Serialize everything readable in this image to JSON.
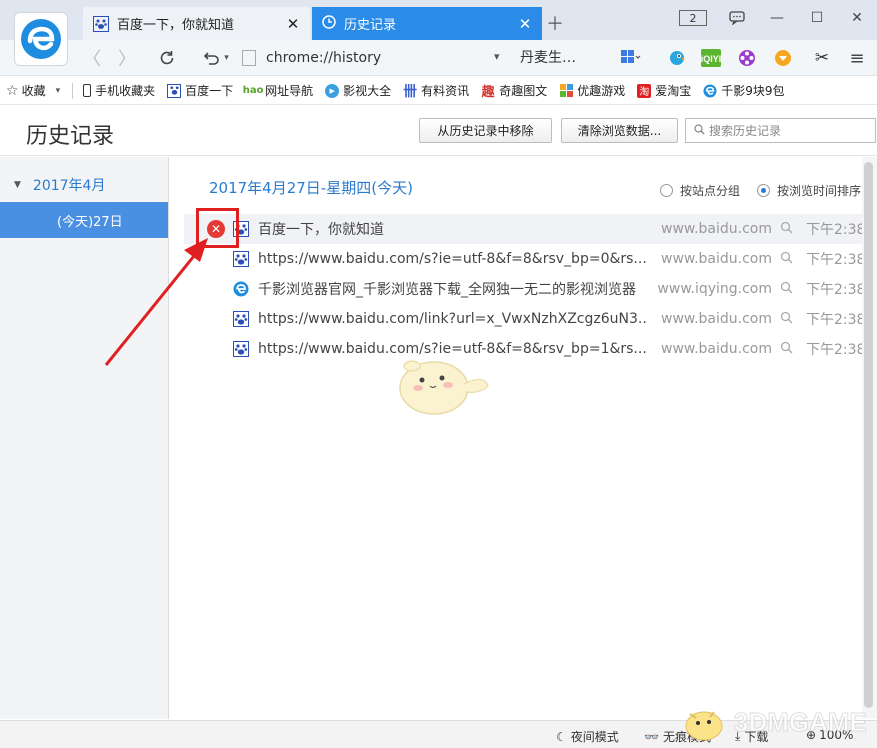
{
  "tabs": [
    {
      "label": "百度一下，你就知道",
      "icon": "baidu-paw-icon",
      "active": false
    },
    {
      "label": "历史记录",
      "icon": "clock-icon",
      "active": true
    }
  ],
  "window": {
    "counter": "2"
  },
  "navbar": {
    "address": "chrome://history",
    "search_engine": "丹麦生…"
  },
  "bookmarks": [
    {
      "label": "收藏",
      "icon": "star-icon"
    },
    {
      "label": "手机收藏夹",
      "icon": "phone-icon"
    },
    {
      "label": "百度一下",
      "icon": "baidu-paw-icon"
    },
    {
      "label": "网址导航",
      "icon": "hao-icon"
    },
    {
      "label": "影视大全",
      "icon": "video-icon"
    },
    {
      "label": "有料资讯",
      "icon": "news-icon"
    },
    {
      "label": "奇趣图文",
      "icon": "fun-icon"
    },
    {
      "label": "优趣游戏",
      "icon": "game-icon"
    },
    {
      "label": "爱淘宝",
      "icon": "taobao-icon"
    },
    {
      "label": "千影9块9包",
      "icon": "qianying-icon"
    }
  ],
  "header": {
    "title": "历史记录",
    "remove_button": "从历史记录中移除",
    "clear_button": "清除浏览数据...",
    "search_placeholder": "搜索历史记录"
  },
  "sidebar": {
    "month": "2017年4月",
    "day": "(今天)27日"
  },
  "main": {
    "date_heading": "2017年4月27日-星期四(今天)",
    "sort_by_site": "按站点分组",
    "sort_by_time": "按浏览时间排序",
    "selected_sort": "time"
  },
  "history_items": [
    {
      "title": "百度一下，你就知道",
      "domain": "www.baidu.com",
      "time": "下午2:38",
      "icon": "baidu-paw-icon",
      "hovered": true
    },
    {
      "title": "https://www.baidu.com/s?ie=utf-8&f=8&rsv_bp=0&rs...",
      "domain": "www.baidu.com",
      "time": "下午2:38",
      "icon": "baidu-paw-icon",
      "hovered": false
    },
    {
      "title": "千影浏览器官网_千影浏览器下载_全网独一无二的影视浏览器",
      "domain": "www.iqying.com",
      "time": "下午2:38",
      "icon": "qianying-icon",
      "hovered": false
    },
    {
      "title": "https://www.baidu.com/link?url=x_VwxNzhXZcgz6uN3...",
      "domain": "www.baidu.com",
      "time": "下午2:38",
      "icon": "baidu-paw-icon",
      "hovered": false
    },
    {
      "title": "https://www.baidu.com/s?ie=utf-8&f=8&rsv_bp=1&rs...",
      "domain": "www.baidu.com",
      "time": "下午2:38",
      "icon": "baidu-paw-icon",
      "hovered": false
    }
  ],
  "statusbar": {
    "night_mode": "夜间模式",
    "incognito": "无痕模式",
    "download": "下载",
    "zoom": "100%"
  },
  "watermark": "3DMGAME",
  "colors": {
    "accent": "#2a8be8",
    "selected_day": "#4a90e2",
    "link_blue": "#2a7ad1",
    "delete_red": "#e53935",
    "annotation_red": "#e02020"
  }
}
